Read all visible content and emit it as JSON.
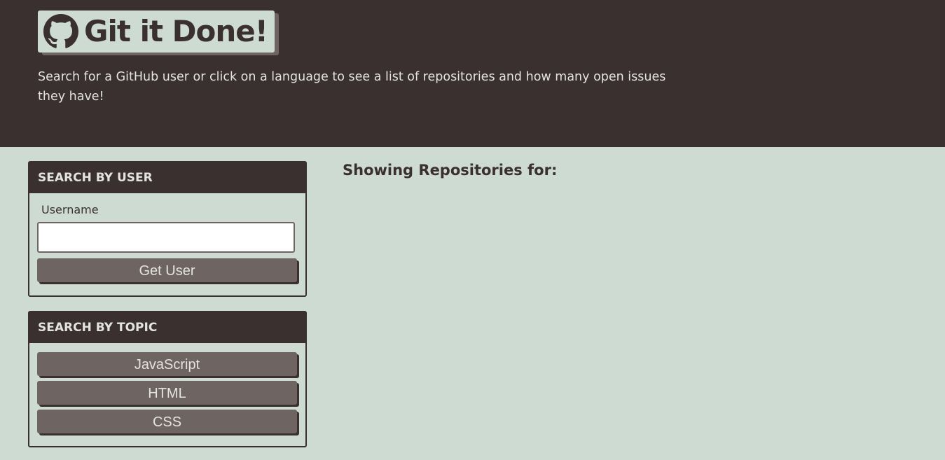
{
  "header": {
    "title": "Git it Done!",
    "logo_icon": "github-icon",
    "subtitle": "Search for a GitHub user or click on a language to see a list of repositories and how many open issues they have!"
  },
  "user_search": {
    "header": "SEARCH BY USER",
    "label": "Username",
    "input_value": "",
    "button_label": "Get User"
  },
  "topic_search": {
    "header": "SEARCH BY TOPIC",
    "topics": [
      "JavaScript",
      "HTML",
      "CSS"
    ]
  },
  "repos": {
    "heading": "Showing Repositories for:",
    "search_term": ""
  },
  "colors": {
    "dark": "#3a3030",
    "light": "#cddbd3",
    "button": "#6e6563",
    "text_light": "#e3e3df"
  }
}
